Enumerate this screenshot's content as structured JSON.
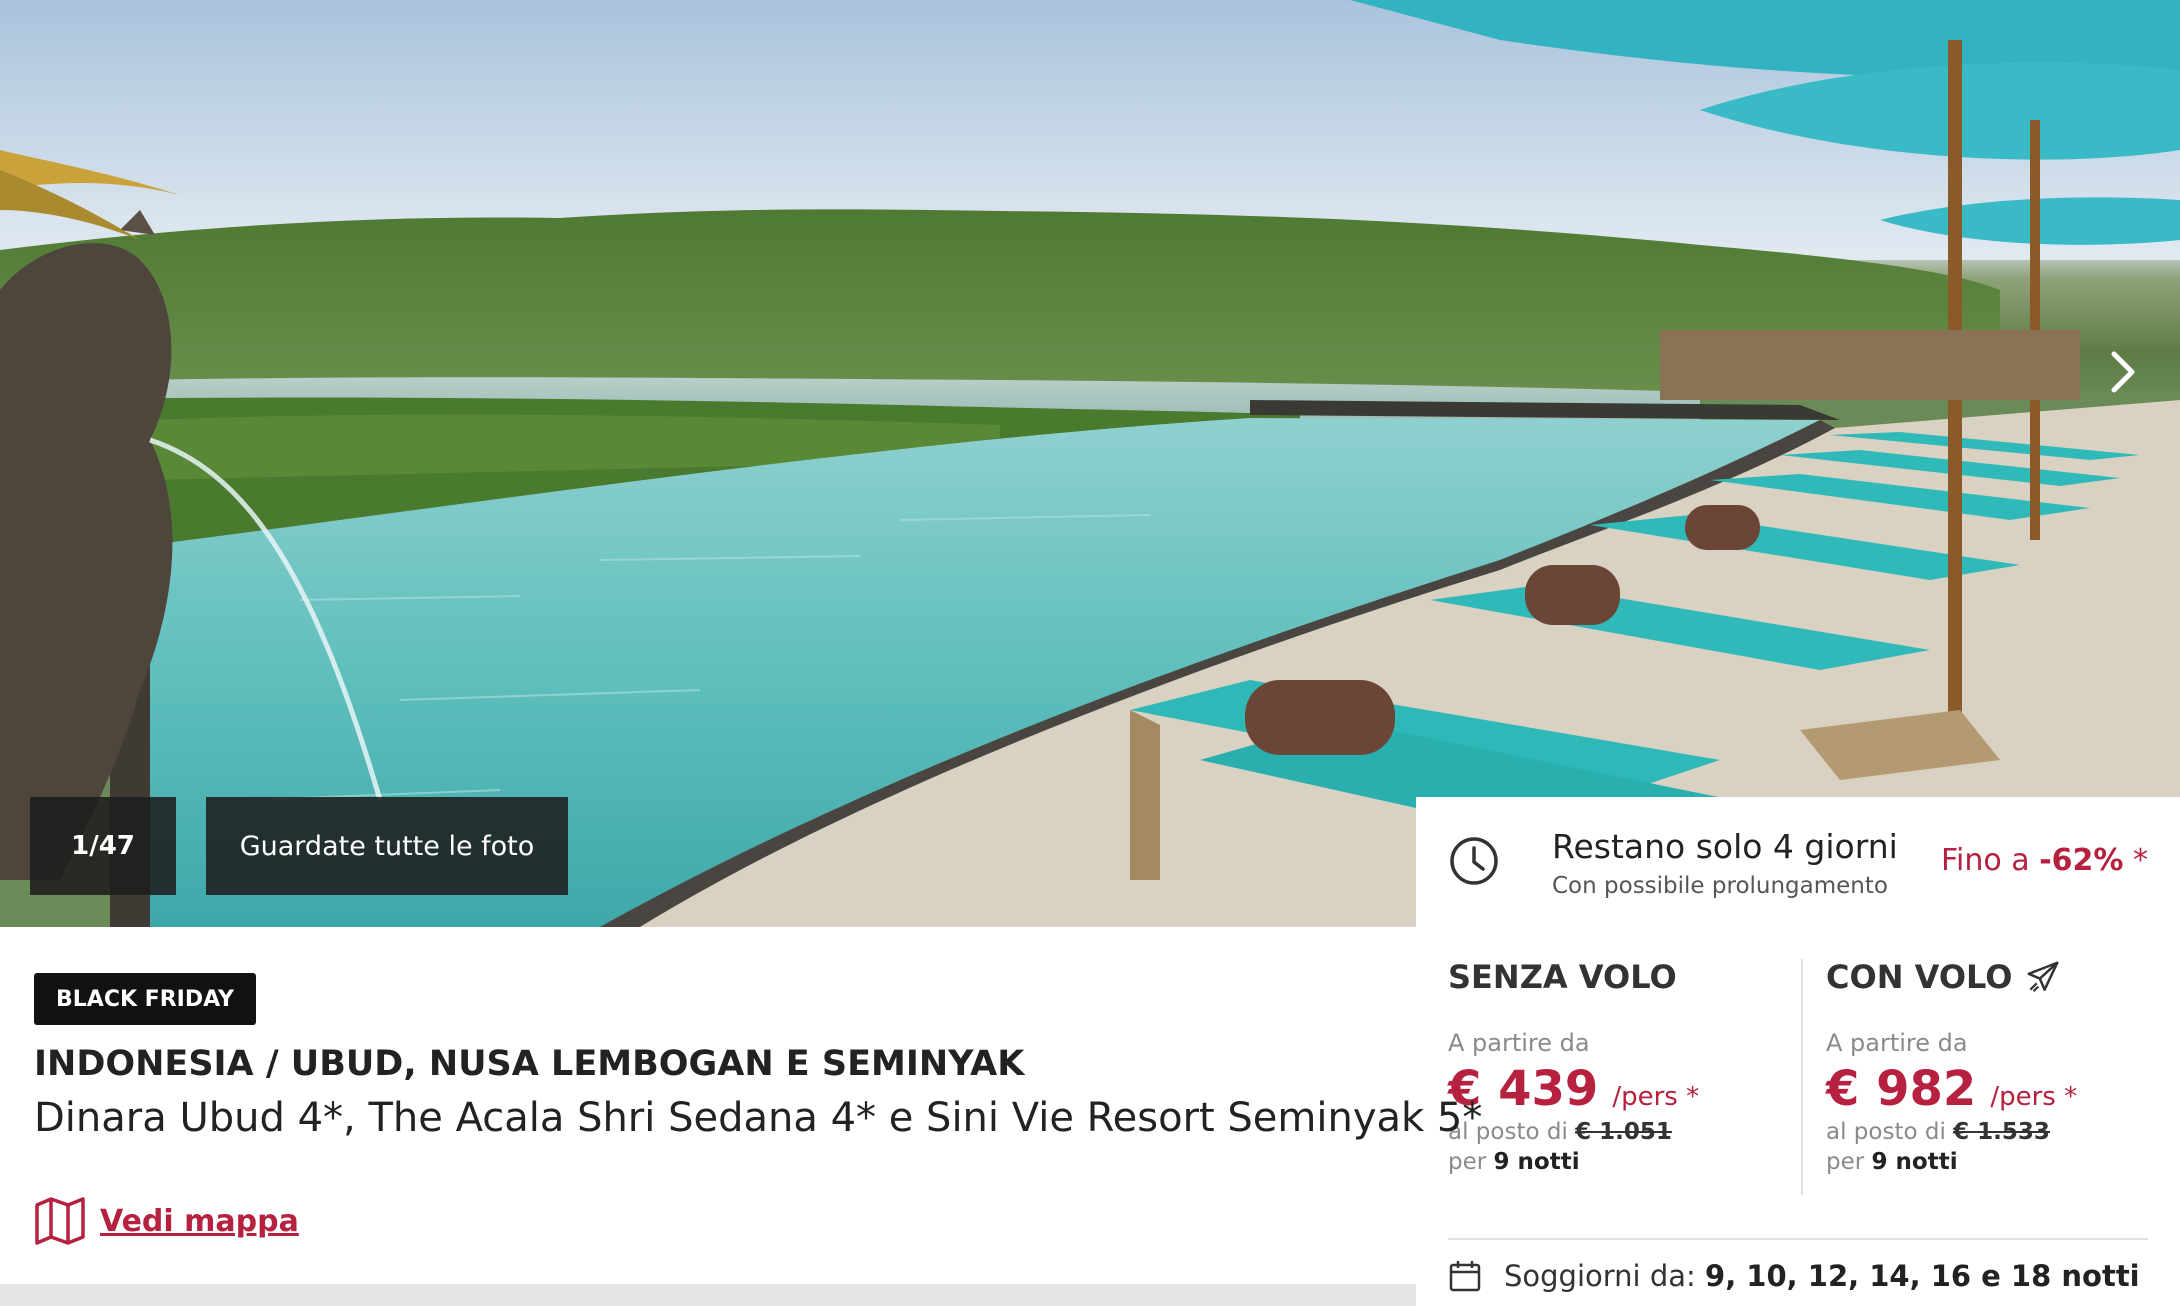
{
  "gallery": {
    "counter": "1/47",
    "view_all_label": "Guardate tutte le foto",
    "next_icon": "chevron-right-icon"
  },
  "offer": {
    "badge": "BLACK FRIDAY",
    "destination": "INDONESIA / UBUD, NUSA LEMBOGAN E SEMINYAK",
    "hotels": "Dinara Ubud 4*, The Acala Shri Sedana 4* e Sini Vie Resort Seminyak 5*",
    "map_label": "Vedi mappa",
    "map_icon": "map-icon"
  },
  "countdown": {
    "title": "Restano solo 4 giorni",
    "subtitle": "Con possibile prolungamento",
    "discount_prefix": "Fino a",
    "discount_value": "-62%",
    "discount_suffix": "*",
    "icon": "clock-icon"
  },
  "pricing": {
    "without_flight": {
      "title": "SENZA VOLO",
      "from_label": "A partire da",
      "price": "€ 439",
      "per": "/pers *",
      "instead_label": "al posto di",
      "old_price": "€ 1.051",
      "per_label": "per",
      "nights": "9 notti"
    },
    "with_flight": {
      "title": "CON VOLO",
      "icon": "airplane-icon",
      "from_label": "A partire da",
      "price": "€ 982",
      "per": "/pers *",
      "instead_label": "al posto di",
      "old_price": "€ 1.533",
      "per_label": "per",
      "nights": "9 notti"
    }
  },
  "stays": {
    "label": "Soggiorni da:",
    "values": "9, 10, 12, 14, 16 e 18 notti",
    "icon": "calendar-icon"
  },
  "colors": {
    "accent": "#b5213f",
    "badge_bg": "#111111",
    "overlay_bg": "#1e1e1e",
    "pool": "#5fc4c2",
    "cushion": "#2fb8b8"
  }
}
